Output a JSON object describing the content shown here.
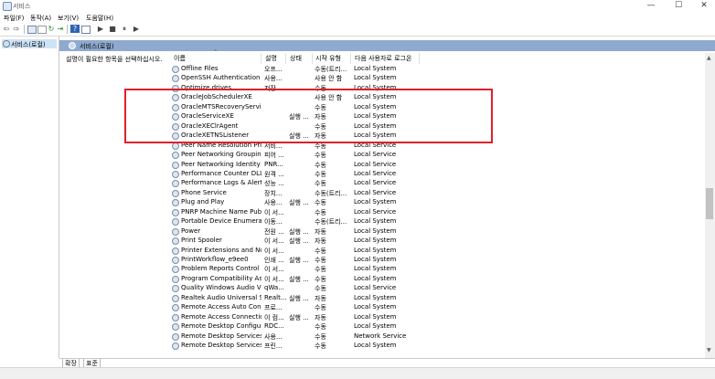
{
  "window": {
    "title": "서비스",
    "controls": [
      "—",
      "☐",
      "✕"
    ]
  },
  "menu": [
    "파일(F)",
    "동작(A)",
    "보기(V)",
    "도움말(H)"
  ],
  "tree": {
    "label": "서비스(로컬)"
  },
  "panel": {
    "header": "서비스(로컬)",
    "description": "설명이 필요한 항목을 선택하십시오."
  },
  "columns": {
    "name": "이름",
    "description": "설명",
    "status": "상태",
    "startup": "시작 유형",
    "logon": "다음 사용자로 로그온"
  },
  "rows": [
    {
      "name": "Offline Files",
      "desc": "오프...",
      "status": "",
      "start": "수동(트리...",
      "logon": "Local System"
    },
    {
      "name": "OpenSSH Authentication A...",
      "desc": "사용...",
      "status": "",
      "start": "사용 안 함",
      "logon": "Local System"
    },
    {
      "name": "Optimize drives",
      "desc": "저장...",
      "status": "",
      "start": "수동",
      "logon": "Local System"
    },
    {
      "name": "OracleJobSchedulerXE",
      "desc": "",
      "status": "",
      "start": "사용 안 함",
      "logon": "Local System"
    },
    {
      "name": "OracleMTSRecoveryService",
      "desc": "",
      "status": "",
      "start": "수동",
      "logon": "Local System"
    },
    {
      "name": "OracleServiceXE",
      "desc": "",
      "status": "실행 ...",
      "start": "자동",
      "logon": "Local System"
    },
    {
      "name": "OracleXEClrAgent",
      "desc": "",
      "status": "",
      "start": "수동",
      "logon": "Local System"
    },
    {
      "name": "OracleXETNSListener",
      "desc": "",
      "status": "실행 ...",
      "start": "자동",
      "logon": "Local System"
    },
    {
      "name": "Peer Name Resolution Prot...",
      "desc": "서비...",
      "status": "",
      "start": "수동",
      "logon": "Local Service"
    },
    {
      "name": "Peer Networking Grouping",
      "desc": "피어 ...",
      "status": "",
      "start": "수동",
      "logon": "Local Service"
    },
    {
      "name": "Peer Networking Identity ...",
      "desc": "PNR...",
      "status": "",
      "start": "수동",
      "logon": "Local Service"
    },
    {
      "name": "Performance Counter DLL ...",
      "desc": "원격 ...",
      "status": "",
      "start": "수동",
      "logon": "Local Service"
    },
    {
      "name": "Performance Logs & Alerts",
      "desc": "성능 ...",
      "status": "",
      "start": "수동",
      "logon": "Local Service"
    },
    {
      "name": "Phone Service",
      "desc": "장치...",
      "status": "",
      "start": "수동(트리...",
      "logon": "Local Service"
    },
    {
      "name": "Plug and Play",
      "desc": "사용...",
      "status": "실행 ...",
      "start": "수동",
      "logon": "Local System"
    },
    {
      "name": "PNRP Machine Name Publi...",
      "desc": "이 서...",
      "status": "",
      "start": "수동",
      "logon": "Local Service"
    },
    {
      "name": "Portable Device Enumerato...",
      "desc": "이동...",
      "status": "",
      "start": "수동(트리...",
      "logon": "Local System"
    },
    {
      "name": "Power",
      "desc": "전원 ...",
      "status": "실행 ...",
      "start": "자동",
      "logon": "Local System"
    },
    {
      "name": "Print Spooler",
      "desc": "이 서...",
      "status": "실행 ...",
      "start": "자동",
      "logon": "Local System"
    },
    {
      "name": "Printer Extensions and Noti...",
      "desc": "이 서...",
      "status": "",
      "start": "수동",
      "logon": "Local System"
    },
    {
      "name": "PrintWorkflow_e9ee0",
      "desc": "인쇄 ...",
      "status": "실행 ...",
      "start": "수동",
      "logon": "Local System"
    },
    {
      "name": "Problem Reports Control P...",
      "desc": "이 서...",
      "status": "",
      "start": "수동",
      "logon": "Local System"
    },
    {
      "name": "Program Compatibility Assi...",
      "desc": "이 서...",
      "status": "실행 ...",
      "start": "수동",
      "logon": "Local System"
    },
    {
      "name": "Quality Windows Audio Vi...",
      "desc": "qWa...",
      "status": "",
      "start": "수동",
      "logon": "Local Service"
    },
    {
      "name": "Realtek Audio Universal Ser...",
      "desc": "Realt...",
      "status": "실행 ...",
      "start": "자동",
      "logon": "Local System"
    },
    {
      "name": "Remote Access Auto Conn...",
      "desc": "프로...",
      "status": "",
      "start": "수동",
      "logon": "Local System"
    },
    {
      "name": "Remote Access Connection...",
      "desc": "이 컴...",
      "status": "실행 ...",
      "start": "자동",
      "logon": "Local System"
    },
    {
      "name": "Remote Desktop Configura...",
      "desc": "RDC...",
      "status": "",
      "start": "수동",
      "logon": "Local System"
    },
    {
      "name": "Remote Desktop Services",
      "desc": "사용...",
      "status": "",
      "start": "수동",
      "logon": "Network Service"
    },
    {
      "name": "Remote Desktop Services ...",
      "desc": "프린...",
      "status": "",
      "start": "수동",
      "logon": "Local System"
    }
  ],
  "tabs": [
    "확장",
    "표준"
  ],
  "colors": {
    "header_band": "#8faad0",
    "highlight": "#e0202a",
    "selection": "#cfe3f7"
  },
  "icons": [
    "gear-icon",
    "back-icon",
    "forward-icon",
    "play-icon",
    "stop-icon",
    "pause-icon",
    "restart-icon",
    "help-icon"
  ]
}
